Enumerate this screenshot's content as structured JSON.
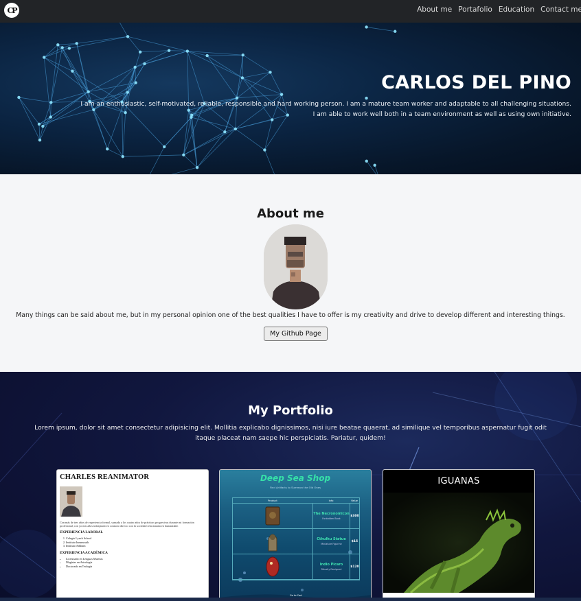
{
  "nav": {
    "logo_icon": "cp-monogram-logo",
    "links": [
      "About me",
      "Portafolio",
      "Education",
      "Contact me"
    ]
  },
  "hero": {
    "name": "CARLOS DEL PINO",
    "description_line1": "I am an enthusiastic, self-motivated, reliable, responsible and hard working person. I am a mature team worker and adaptable to all challenging situations.",
    "description_line2": "I am able to work well both in a team environment as well as using own initiative."
  },
  "about": {
    "title": "About me",
    "text": "Many things can be said about me, but in my personal opinion one of the best qualities I have to offer is my creativity and drive to develop different and interesting things.",
    "button": "My Github Page"
  },
  "portfolio": {
    "title": "My Portfolio",
    "description": "Lorem ipsum, dolor sit amet consectetur adipisicing elit. Mollitia explicabo dignissimos, nisi iure beatae quaerat, ad similique vel temporibus aspernatur fugit odit itaque placeat nam saepe hic perspiciatis. Pariatur, quidem!",
    "cards": [
      {
        "title": "CHARLES REANIMATOR",
        "paragraph": "Con más de tres años de experiencia formal, sumada a los cuatro años de prácticas progresivas durante mi formación profesional, con yo mis años trabajando en contacto directo con la sociedad relacionada en humanidad.",
        "section1": "EXPERIENCIA LABORAL",
        "section1_items": [
          "Colegio Lynch School",
          "Instituto Innsmouth",
          "Instituto Arkham"
        ],
        "section2": "EXPERIENCIA ACADÉMICA",
        "section2_items": [
          "Licenciado en Lenguas Muertas",
          "Magíster en Astrología",
          "Doctorado en Teología"
        ]
      },
      {
        "title": "Deep Sea Shop",
        "subtitle": "Find Artifacts to Summon the Old Ones",
        "headers": [
          "Product",
          "Info",
          "Value"
        ],
        "rows": [
          {
            "name": "The Necronomicon",
            "sub": "Forbidden Book",
            "price": "$300"
          },
          {
            "name": "Cthulhu Statue",
            "sub": "Miniature Figurine",
            "price": "$15"
          },
          {
            "name": "Indio Picaro",
            "sub": "Ritually Designed",
            "price": "$120"
          }
        ],
        "footer": "Go to Cart"
      },
      {
        "title": "IGUANAS"
      }
    ]
  }
}
